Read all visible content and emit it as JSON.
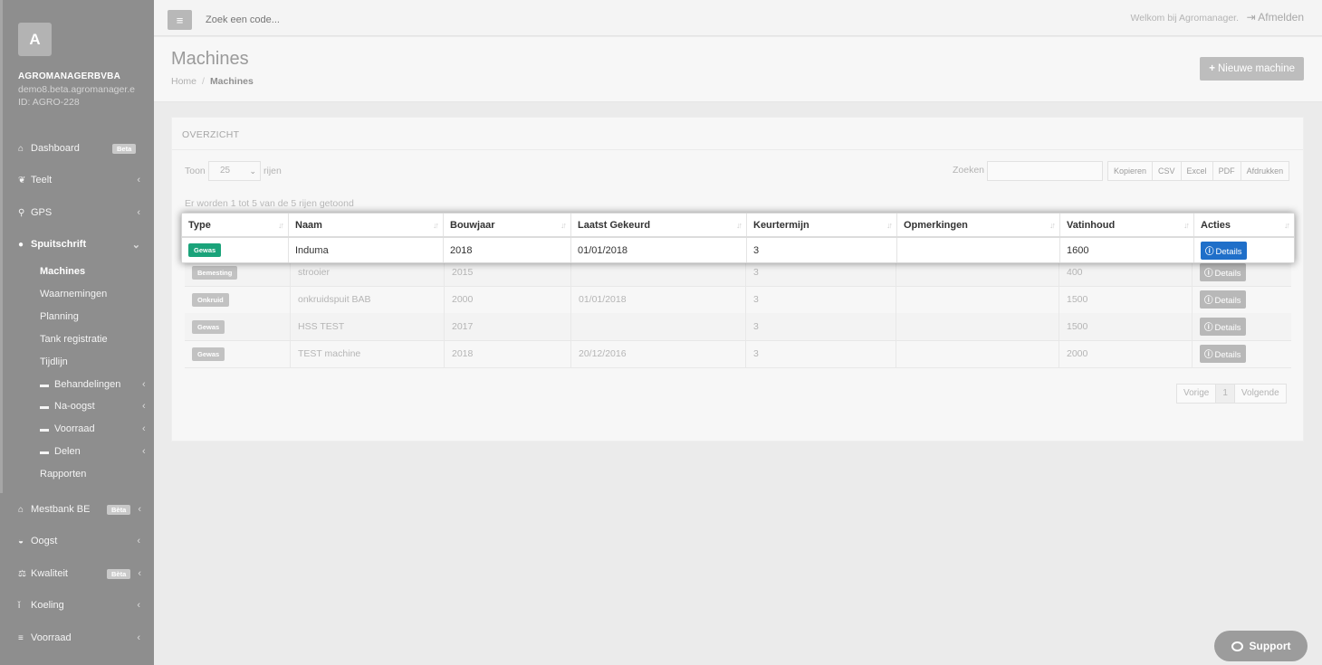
{
  "sidebar": {
    "logo_letter": "A",
    "company": "AGROMANAGERBVBA",
    "email": "demo8.beta.agromanager.e",
    "account_id": "ID: AGRO-228",
    "items": [
      {
        "label": "Dashboard",
        "icon": "home-icon",
        "badge": "Beta"
      },
      {
        "label": "Teelt",
        "icon": "leaf-icon"
      },
      {
        "label": "GPS",
        "icon": "map-marker-icon"
      },
      {
        "label": "Spuitschrift",
        "icon": "drop-icon"
      },
      {
        "label": "Mestbank BE",
        "icon": "bank-icon",
        "badge": "Bèta"
      },
      {
        "label": "Oogst",
        "icon": "basket-icon"
      },
      {
        "label": "Kwaliteit",
        "icon": "scale-icon",
        "badge": "Bèta"
      },
      {
        "label": "Koeling",
        "icon": "thermometer-icon"
      },
      {
        "label": "Voorraad",
        "icon": "list-icon"
      }
    ],
    "sub_items": [
      "Machines",
      "Waarnemingen",
      "Planning",
      "Tank registratie",
      "Tijdlijn",
      "Behandelingen",
      "Na-oogst",
      "Voorraad",
      "Delen",
      "Rapporten"
    ]
  },
  "topbar": {
    "search_placeholder": "Zoek een code...",
    "welcome": "Welkom bij Agromanager.",
    "logout": "Afmelden"
  },
  "header": {
    "title": "Machines",
    "breadcrumb_home": "Home",
    "breadcrumb_sep": "/",
    "breadcrumb_current": "Machines",
    "new_button": "Nieuwe machine"
  },
  "panel": {
    "title": "OVERZICHT",
    "toon": "Toon",
    "page_length": "25",
    "rijen": "rijen",
    "search_label": "Zoeken",
    "export_buttons": [
      "Kopieren",
      "CSV",
      "Excel",
      "PDF",
      "Afdrukken"
    ],
    "info": "Er worden 1 tot 5 van de 5 rijen getoond"
  },
  "table": {
    "columns": [
      "Type",
      "Naam",
      "Bouwjaar",
      "Laatst Gekeurd",
      "Keurtermijn",
      "Opmerkingen",
      "Vatinhoud",
      "Acties"
    ],
    "rows": [
      {
        "type": "Gewas",
        "naam": "Induma",
        "bouwjaar": "2018",
        "gekeurd": "01/01/2018",
        "termijn": "3",
        "opm": "",
        "vat": "1600",
        "actie": "Details"
      },
      {
        "type": "Bemesting",
        "naam": "strooier",
        "bouwjaar": "2015",
        "gekeurd": "",
        "termijn": "3",
        "opm": "",
        "vat": "400",
        "actie": "Details"
      },
      {
        "type": "Onkruid",
        "naam": "onkruidspuit BAB",
        "bouwjaar": "2000",
        "gekeurd": "01/01/2018",
        "termijn": "3",
        "opm": "",
        "vat": "1500",
        "actie": "Details"
      },
      {
        "type": "Gewas",
        "naam": "HSS TEST",
        "bouwjaar": "2017",
        "gekeurd": "",
        "termijn": "3",
        "opm": "",
        "vat": "1500",
        "actie": "Details"
      },
      {
        "type": "Gewas",
        "naam": "TEST machine",
        "bouwjaar": "2018",
        "gekeurd": "20/12/2016",
        "termijn": "3",
        "opm": "",
        "vat": "2000",
        "actie": "Details"
      }
    ]
  },
  "pagination": {
    "prev": "Vorige",
    "page": "1",
    "next": "Volgende"
  },
  "support": "Support",
  "colors": {
    "accent_green": "#1aa37a",
    "accent_blue": "#1f6fc9",
    "sidebar": "#8e8e8e"
  }
}
